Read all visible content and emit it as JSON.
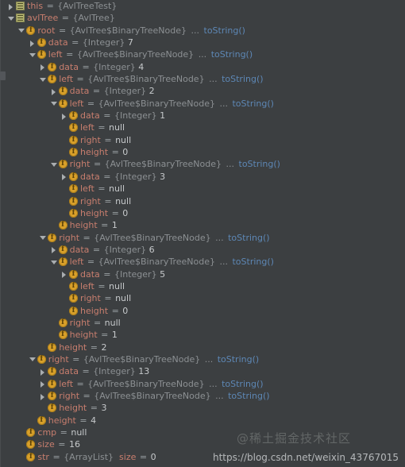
{
  "panel": {
    "name": "debugger-variables-tree",
    "background": "#3c3f41",
    "colors": {
      "variable_name": "#c87e6e",
      "type": "#8c9093",
      "to_string_link": "#5d87b5",
      "value": "#c6c9cb",
      "field_icon": "#d8a02a",
      "local_icon": "#b3b372"
    }
  },
  "watermarks": {
    "community": "@稀土掘金技术社区",
    "url": "https://blog.csdn.net/weixin_43767015"
  },
  "rows": [
    {
      "depth": 0,
      "toggle": "collapsed",
      "icon": "local-variable-icon",
      "name": "this",
      "eq": "=",
      "type": "{AvlTreeTest}",
      "dots": "",
      "tostring": "",
      "value": ""
    },
    {
      "depth": 0,
      "toggle": "expanded",
      "icon": "local-variable-icon",
      "name": "avlTree",
      "eq": "=",
      "type": "{AvlTree}",
      "dots": "",
      "tostring": "",
      "value": ""
    },
    {
      "depth": 1,
      "toggle": "expanded",
      "icon": "field-icon",
      "name": "root",
      "eq": "=",
      "type": "{AvlTree$BinaryTreeNode}",
      "dots": "...",
      "tostring": "toString()",
      "value": ""
    },
    {
      "depth": 2,
      "toggle": "collapsed",
      "icon": "field-icon",
      "name": "data",
      "eq": "=",
      "type": "{Integer}",
      "dots": "",
      "tostring": "",
      "value": "7"
    },
    {
      "depth": 2,
      "toggle": "expanded",
      "icon": "field-icon",
      "name": "left",
      "eq": "=",
      "type": "{AvlTree$BinaryTreeNode}",
      "dots": "...",
      "tostring": "toString()",
      "value": ""
    },
    {
      "depth": 3,
      "toggle": "collapsed",
      "icon": "field-icon",
      "name": "data",
      "eq": "=",
      "type": "{Integer}",
      "dots": "",
      "tostring": "",
      "value": "4"
    },
    {
      "depth": 3,
      "toggle": "expanded",
      "icon": "field-icon",
      "name": "left",
      "eq": "=",
      "type": "{AvlTree$BinaryTreeNode}",
      "dots": "...",
      "tostring": "toString()",
      "value": ""
    },
    {
      "depth": 4,
      "toggle": "collapsed",
      "icon": "field-icon",
      "name": "data",
      "eq": "=",
      "type": "{Integer}",
      "dots": "",
      "tostring": "",
      "value": "2"
    },
    {
      "depth": 4,
      "toggle": "expanded",
      "icon": "field-icon",
      "name": "left",
      "eq": "=",
      "type": "{AvlTree$BinaryTreeNode}",
      "dots": "...",
      "tostring": "toString()",
      "value": ""
    },
    {
      "depth": 5,
      "toggle": "collapsed",
      "icon": "field-icon",
      "name": "data",
      "eq": "=",
      "type": "{Integer}",
      "dots": "",
      "tostring": "",
      "value": "1"
    },
    {
      "depth": 5,
      "toggle": "none",
      "icon": "field-icon",
      "name": "left",
      "eq": "=",
      "type": "",
      "dots": "",
      "tostring": "",
      "value": "null"
    },
    {
      "depth": 5,
      "toggle": "none",
      "icon": "field-icon",
      "name": "right",
      "eq": "=",
      "type": "",
      "dots": "",
      "tostring": "",
      "value": "null"
    },
    {
      "depth": 5,
      "toggle": "none",
      "icon": "field-icon",
      "name": "height",
      "eq": "=",
      "type": "",
      "dots": "",
      "tostring": "",
      "value": "0"
    },
    {
      "depth": 4,
      "toggle": "expanded",
      "icon": "field-icon",
      "name": "right",
      "eq": "=",
      "type": "{AvlTree$BinaryTreeNode}",
      "dots": "...",
      "tostring": "toString()",
      "value": ""
    },
    {
      "depth": 5,
      "toggle": "collapsed",
      "icon": "field-icon",
      "name": "data",
      "eq": "=",
      "type": "{Integer}",
      "dots": "",
      "tostring": "",
      "value": "3"
    },
    {
      "depth": 5,
      "toggle": "none",
      "icon": "field-icon",
      "name": "left",
      "eq": "=",
      "type": "",
      "dots": "",
      "tostring": "",
      "value": "null"
    },
    {
      "depth": 5,
      "toggle": "none",
      "icon": "field-icon",
      "name": "right",
      "eq": "=",
      "type": "",
      "dots": "",
      "tostring": "",
      "value": "null"
    },
    {
      "depth": 5,
      "toggle": "none",
      "icon": "field-icon",
      "name": "height",
      "eq": "=",
      "type": "",
      "dots": "",
      "tostring": "",
      "value": "0"
    },
    {
      "depth": 4,
      "toggle": "none",
      "icon": "field-icon",
      "name": "height",
      "eq": "=",
      "type": "",
      "dots": "",
      "tostring": "",
      "value": "1"
    },
    {
      "depth": 3,
      "toggle": "expanded",
      "icon": "field-icon",
      "name": "right",
      "eq": "=",
      "type": "{AvlTree$BinaryTreeNode}",
      "dots": "...",
      "tostring": "toString()",
      "value": ""
    },
    {
      "depth": 4,
      "toggle": "collapsed",
      "icon": "field-icon",
      "name": "data",
      "eq": "=",
      "type": "{Integer}",
      "dots": "",
      "tostring": "",
      "value": "6"
    },
    {
      "depth": 4,
      "toggle": "expanded",
      "icon": "field-icon",
      "name": "left",
      "eq": "=",
      "type": "{AvlTree$BinaryTreeNode}",
      "dots": "...",
      "tostring": "toString()",
      "value": ""
    },
    {
      "depth": 5,
      "toggle": "collapsed",
      "icon": "field-icon",
      "name": "data",
      "eq": "=",
      "type": "{Integer}",
      "dots": "",
      "tostring": "",
      "value": "5"
    },
    {
      "depth": 5,
      "toggle": "none",
      "icon": "field-icon",
      "name": "left",
      "eq": "=",
      "type": "",
      "dots": "",
      "tostring": "",
      "value": "null"
    },
    {
      "depth": 5,
      "toggle": "none",
      "icon": "field-icon",
      "name": "right",
      "eq": "=",
      "type": "",
      "dots": "",
      "tostring": "",
      "value": "null"
    },
    {
      "depth": 5,
      "toggle": "none",
      "icon": "field-icon",
      "name": "height",
      "eq": "=",
      "type": "",
      "dots": "",
      "tostring": "",
      "value": "0"
    },
    {
      "depth": 4,
      "toggle": "none",
      "icon": "field-icon",
      "name": "right",
      "eq": "=",
      "type": "",
      "dots": "",
      "tostring": "",
      "value": "null"
    },
    {
      "depth": 4,
      "toggle": "none",
      "icon": "field-icon",
      "name": "height",
      "eq": "=",
      "type": "",
      "dots": "",
      "tostring": "",
      "value": "1"
    },
    {
      "depth": 3,
      "toggle": "none",
      "icon": "field-icon",
      "name": "height",
      "eq": "=",
      "type": "",
      "dots": "",
      "tostring": "",
      "value": "2"
    },
    {
      "depth": 2,
      "toggle": "expanded",
      "icon": "field-icon",
      "name": "right",
      "eq": "=",
      "type": "{AvlTree$BinaryTreeNode}",
      "dots": "...",
      "tostring": "toString()",
      "value": ""
    },
    {
      "depth": 3,
      "toggle": "collapsed",
      "icon": "field-icon",
      "name": "data",
      "eq": "=",
      "type": "{Integer}",
      "dots": "",
      "tostring": "",
      "value": "13"
    },
    {
      "depth": 3,
      "toggle": "collapsed",
      "icon": "field-icon",
      "name": "left",
      "eq": "=",
      "type": "{AvlTree$BinaryTreeNode}",
      "dots": "...",
      "tostring": "toString()",
      "value": ""
    },
    {
      "depth": 3,
      "toggle": "collapsed",
      "icon": "field-icon",
      "name": "right",
      "eq": "=",
      "type": "{AvlTree$BinaryTreeNode}",
      "dots": "...",
      "tostring": "toString()",
      "value": ""
    },
    {
      "depth": 3,
      "toggle": "none",
      "icon": "field-icon",
      "name": "height",
      "eq": "=",
      "type": "",
      "dots": "",
      "tostring": "",
      "value": "3"
    },
    {
      "depth": 2,
      "toggle": "none",
      "icon": "field-icon",
      "name": "height",
      "eq": "=",
      "type": "",
      "dots": "",
      "tostring": "",
      "value": "4"
    },
    {
      "depth": 1,
      "toggle": "none",
      "icon": "field-icon",
      "name": "cmp",
      "eq": "=",
      "type": "",
      "dots": "",
      "tostring": "",
      "value": "null"
    },
    {
      "depth": 1,
      "toggle": "none",
      "icon": "field-icon",
      "name": "size",
      "eq": "=",
      "type": "",
      "dots": "",
      "tostring": "",
      "value": "16"
    },
    {
      "depth": 1,
      "toggle": "none",
      "icon": "field-icon",
      "name": "str",
      "eq": "=",
      "type": "{ArrayList}",
      "dots": "",
      "tostring": "",
      "value": "",
      "extra_name": "size",
      "extra_eq": "=",
      "extra_value": "0"
    }
  ]
}
